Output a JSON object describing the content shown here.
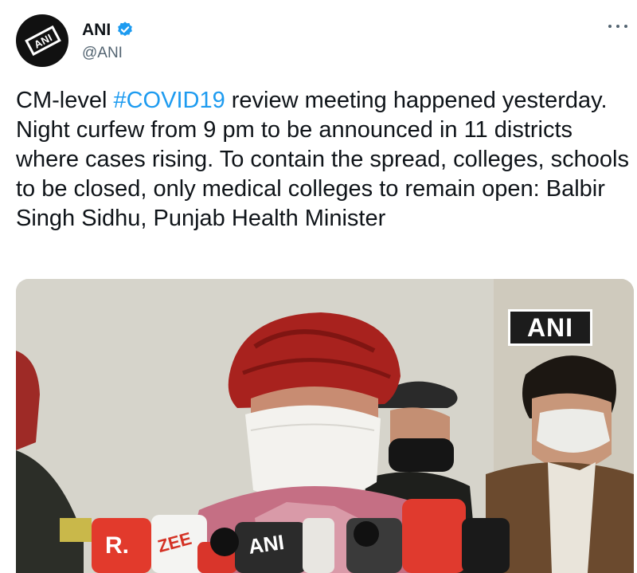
{
  "account": {
    "display_name": "ANI",
    "handle": "@ANI",
    "avatar_logo_text": "ANI",
    "verified": true
  },
  "tweet": {
    "text_before_hashtag": "CM-level ",
    "hashtag": "#COVID19",
    "text_after_hashtag": " review meeting happened yesterday. Night curfew from 9 pm to be announced in 11 districts where cases rising. To contain the spread, colleges, schools to be closed, only medical colleges to remain open: Balbir Singh Sidhu, Punjab Health Minister"
  },
  "media": {
    "watermark": "ANI",
    "mic_labels": {
      "republic": "R.",
      "zee": "ZEE",
      "ani": "ANI"
    }
  },
  "colors": {
    "hashtag": "#1d9bf0",
    "verified_badge": "#1d9bf0",
    "secondary_text": "#536471"
  }
}
